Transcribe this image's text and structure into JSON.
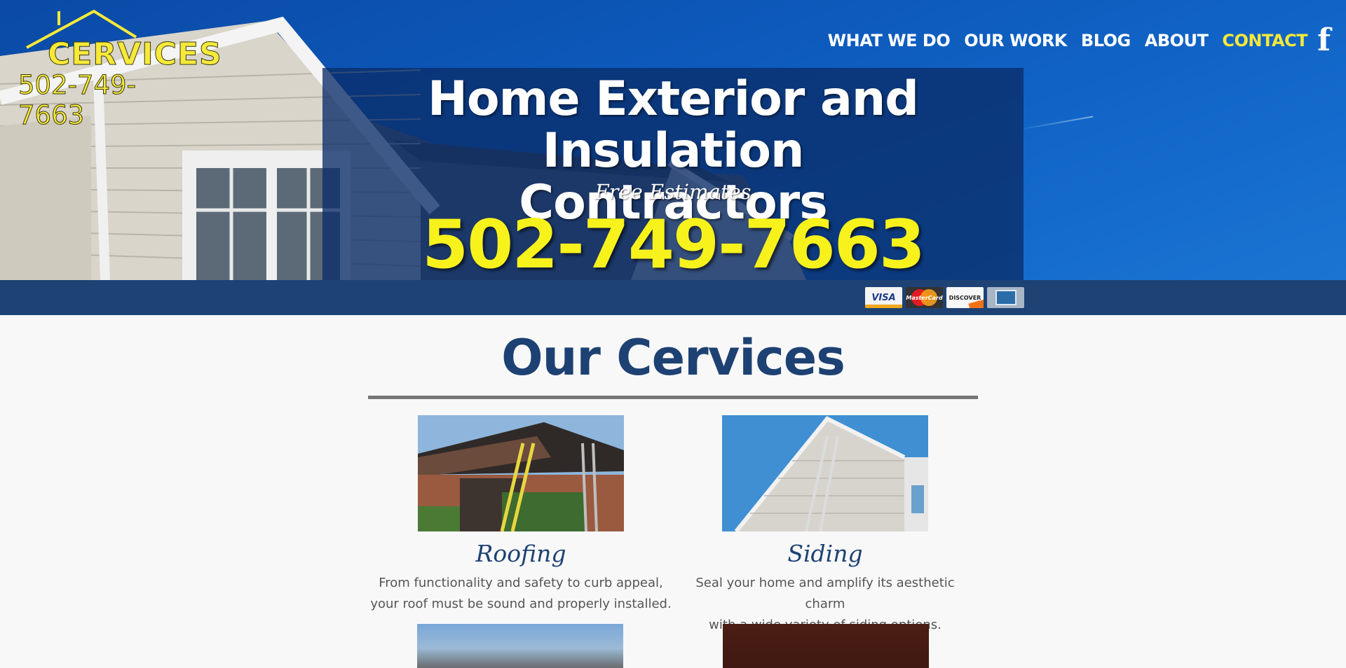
{
  "header": {
    "logo_word": "CERVICES",
    "logo_phone": "502-749-7663",
    "nav": [
      {
        "label": "WHAT WE DO"
      },
      {
        "label": "OUR WORK"
      },
      {
        "label": "BLOG"
      },
      {
        "label": "ABOUT"
      },
      {
        "label": "CONTACT"
      }
    ],
    "facebook_glyph": "f"
  },
  "hero": {
    "headline_line1": "Home Exterior and Insulation",
    "headline_line2": "Contractors",
    "subhead": "Free Estimates",
    "phone": "502-749-7663"
  },
  "payment": {
    "cards": [
      "VISA",
      "MasterCard",
      "DISCOVER",
      "AMERICAN EXPRESS"
    ]
  },
  "services": {
    "title": "Our Cervices",
    "items": [
      {
        "name": "Roofing",
        "desc_line1": "From functionality and safety to curb appeal,",
        "desc_line2": "your roof must be sound and properly installed."
      },
      {
        "name": "Siding",
        "desc_line1": "Seal your home and amplify its aesthetic charm",
        "desc_line2": "with a wide variety of siding options."
      }
    ]
  },
  "colors": {
    "brand_blue": "#1d4173",
    "accent_yellow": "#f6e93a",
    "paybar": "#1e4274"
  }
}
